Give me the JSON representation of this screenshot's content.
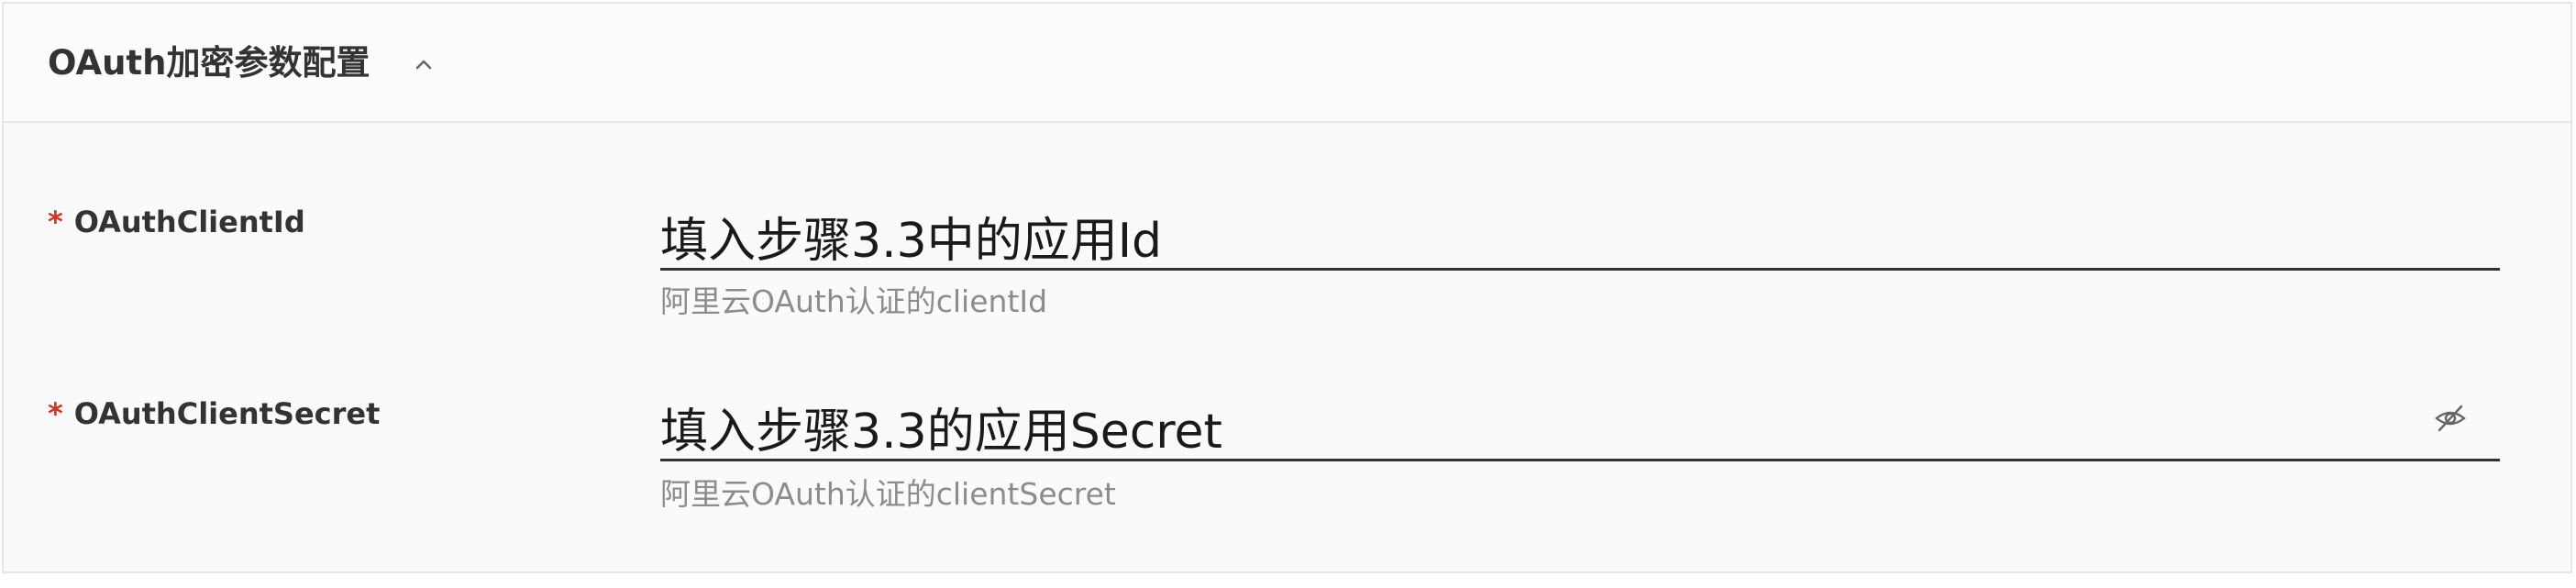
{
  "section": {
    "title": "OAuth加密参数配置",
    "collapse_icon": "chevron-up-icon"
  },
  "fields": [
    {
      "required_mark": "*",
      "label": "OAuthClientId",
      "value": "填入步骤3.3中的应用Id",
      "help": "阿里云OAuth认证的clientId"
    },
    {
      "required_mark": "*",
      "label": "OAuthClientSecret",
      "value": "填入步骤3.3的应用Secret",
      "help": "阿里云OAuth认证的clientSecret",
      "toggle_icon": "eye-off-icon"
    }
  ],
  "colors": {
    "required": "#d93026",
    "label": "#333333",
    "help": "#8c8c8c",
    "border": "#e6e6e6"
  }
}
